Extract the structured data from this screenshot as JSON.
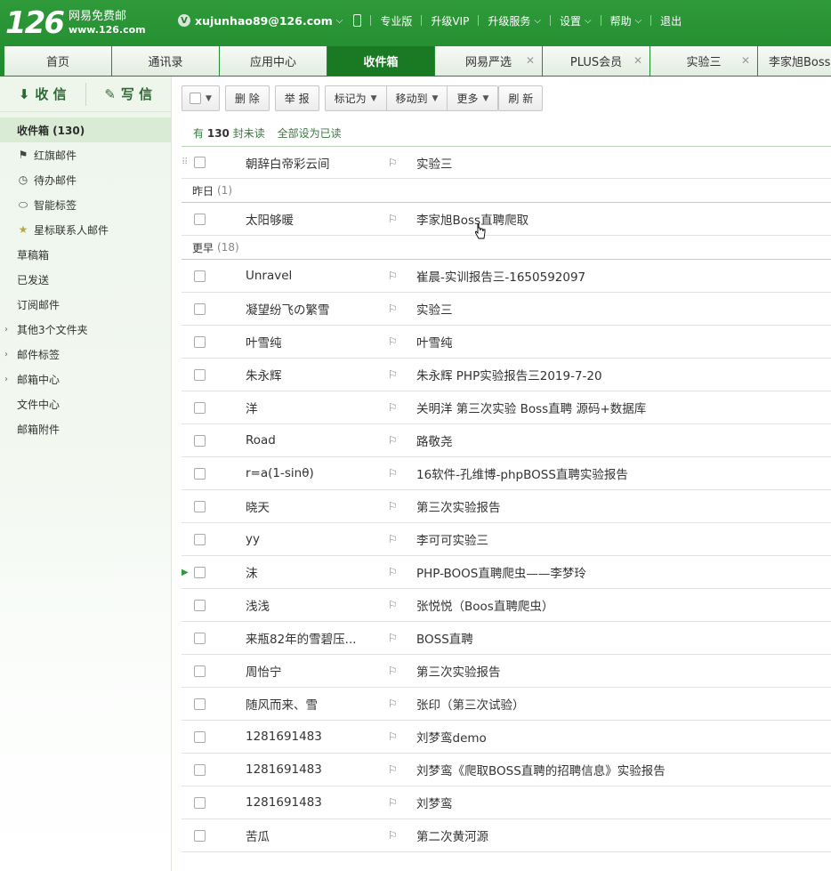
{
  "header": {
    "logo_num": "126",
    "logo_title": "网易免费邮",
    "logo_url": "www.126.com",
    "v_badge": "V",
    "account": "xujunhao89@126.com",
    "links": [
      "专业版",
      "升级VIP",
      "升级服务",
      "设置",
      "帮助",
      "退出"
    ]
  },
  "tabs": [
    {
      "label": "首页"
    },
    {
      "label": "通讯录"
    },
    {
      "label": "应用中心"
    },
    {
      "label": "收件箱",
      "active": true
    },
    {
      "label": "网易严选",
      "closable": true
    },
    {
      "label": "PLUS会员",
      "closable": true
    },
    {
      "label": "实验三",
      "closable": true
    },
    {
      "label": "李家旭Boss"
    }
  ],
  "sidebar": {
    "receive": "收 信",
    "compose": "写 信",
    "folders": [
      {
        "label": "收件箱 (130)"
      },
      {
        "label": "红旗邮件",
        "icon": "flag-icon"
      },
      {
        "label": "待办邮件",
        "icon": "clock-icon"
      },
      {
        "label": "智能标签",
        "icon": "tag-icon"
      },
      {
        "label": "星标联系人邮件",
        "icon": "star-icon"
      },
      {
        "label": "草稿箱"
      },
      {
        "label": "已发送"
      },
      {
        "label": "订阅邮件"
      },
      {
        "label": "其他3个文件夹"
      },
      {
        "label": "邮件标签"
      },
      {
        "label": "邮箱中心"
      },
      {
        "label": "文件中心"
      },
      {
        "label": "邮箱附件"
      }
    ]
  },
  "toolbar": {
    "delete": "删 除",
    "report": "举 报",
    "mark_as": "标记为",
    "move_to": "移动到",
    "more": "更多",
    "refresh": "刷 新"
  },
  "unread": {
    "prefix": "有",
    "count": "130",
    "suffix": "封未读",
    "mark_all": "全部设为已读"
  },
  "pinned_row": {
    "sender": "朝辞白帝彩云间",
    "subject": "实验三"
  },
  "groups": {
    "yesterday": {
      "label": "昨日",
      "count": "(1)"
    },
    "earlier": {
      "label": "更早",
      "count": "(18)"
    }
  },
  "yesterday_rows": [
    {
      "sender": "太阳够暖",
      "subject": "李家旭Boss直聘爬取"
    }
  ],
  "earlier_rows": [
    {
      "sender": "Unravel",
      "subject": "崔晨-实训报告三-1650592097"
    },
    {
      "sender": "凝望纷飞の繁雪",
      "subject": "实验三"
    },
    {
      "sender": "叶雪纯",
      "subject": "叶雪纯"
    },
    {
      "sender": "朱永辉",
      "subject": "朱永辉 PHP实验报告三2019-7-20"
    },
    {
      "sender": "洋",
      "subject": "关明洋 第三次实验 Boss直聘 源码+数据库"
    },
    {
      "sender": "Road",
      "subject": "路敬尧"
    },
    {
      "sender": "r=a(1-sinθ)",
      "subject": "16软件-孔维博-phpBOSS直聘实验报告"
    },
    {
      "sender": "晓天",
      "subject": "第三次实验报告"
    },
    {
      "sender": "yy",
      "subject": "李可可实验三"
    },
    {
      "sender": "沫",
      "subject": "PHP-BOOS直聘爬虫——李梦玲"
    },
    {
      "sender": "浅浅",
      "subject": "张悦悦（Boos直聘爬虫）"
    },
    {
      "sender": "来瓶82年的雪碧压...",
      "subject": "BOSS直聘"
    },
    {
      "sender": "周怡宁",
      "subject": "第三次实验报告"
    },
    {
      "sender": "随风而来、雪",
      "subject": "张印（第三次试验）"
    },
    {
      "sender": "1281691483",
      "subject": "刘梦鸾demo"
    },
    {
      "sender": "1281691483",
      "subject": "刘梦鸾《爬取BOSS直聘的招聘信息》实验报告"
    },
    {
      "sender": "1281691483",
      "subject": "刘梦鸾"
    },
    {
      "sender": "苦瓜",
      "subject": "第二次黄河源"
    }
  ],
  "colors": {
    "brand_green": "#2f9a3a",
    "active_tab": "#1a7a24"
  }
}
